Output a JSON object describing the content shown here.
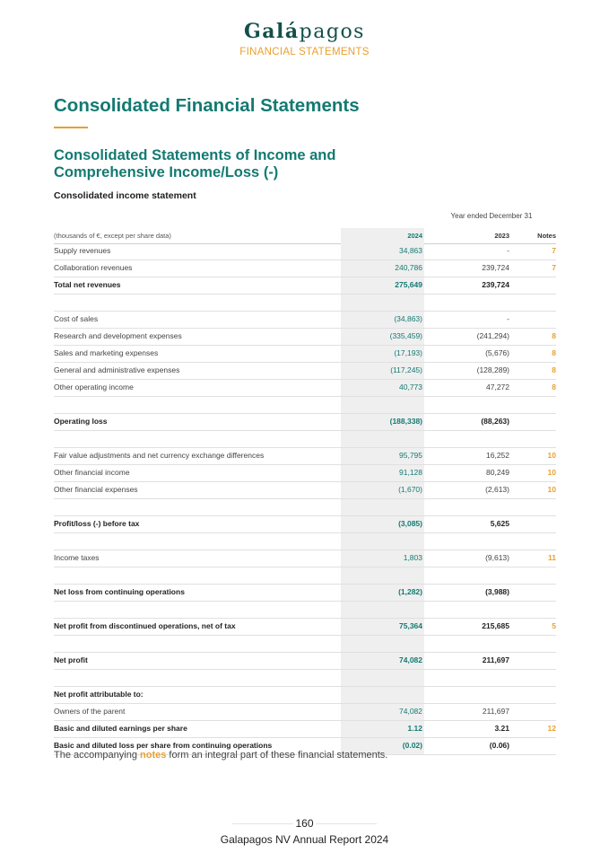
{
  "header": {
    "logo_bold": "Galá",
    "logo_light": "pagos",
    "subtitle": "FINANCIAL STATEMENTS"
  },
  "title": "Consolidated Financial Statements",
  "section_title_line1": "Consolidated Statements of Income and",
  "section_title_line2": "Comprehensive Income/Loss (-)",
  "subsection_title": "Consolidated income statement",
  "table": {
    "period_header": "Year ended December 31",
    "columns": {
      "label": "(thousands of €, except per share data)",
      "y2024": "2024",
      "y2023": "2023",
      "notes": "Notes"
    },
    "rows": [
      {
        "label": "Supply revenues",
        "y2024": "34,863",
        "y2023": "-",
        "note": "7",
        "bold": false
      },
      {
        "label": "Collaboration revenues",
        "y2024": "240,786",
        "y2023": "239,724",
        "note": "7",
        "bold": false
      },
      {
        "label": "Total net revenues",
        "y2024": "275,649",
        "y2023": "239,724",
        "note": "",
        "bold": true
      },
      {
        "label": "",
        "y2024": "",
        "y2023": "",
        "note": "",
        "bold": false
      },
      {
        "label": "Cost of sales",
        "y2024": "(34,863)",
        "y2023": "-",
        "note": "",
        "bold": false
      },
      {
        "label": "Research and development expenses",
        "y2024": "(335,459)",
        "y2023": "(241,294)",
        "note": "8",
        "bold": false
      },
      {
        "label": "Sales and marketing expenses",
        "y2024": "(17,193)",
        "y2023": "(5,676)",
        "note": "8",
        "bold": false
      },
      {
        "label": "General and administrative expenses",
        "y2024": "(117,245)",
        "y2023": "(128,289)",
        "note": "8",
        "bold": false
      },
      {
        "label": "Other operating income",
        "y2024": "40,773",
        "y2023": "47,272",
        "note": "8",
        "bold": false
      },
      {
        "label": "",
        "y2024": "",
        "y2023": "",
        "note": "",
        "bold": false
      },
      {
        "label": "Operating loss",
        "y2024": "(188,338)",
        "y2023": "(88,263)",
        "note": "",
        "bold": true
      },
      {
        "label": "",
        "y2024": "",
        "y2023": "",
        "note": "",
        "bold": false
      },
      {
        "label": "Fair value adjustments and net currency exchange differences",
        "y2024": "95,795",
        "y2023": "16,252",
        "note": "10",
        "bold": false
      },
      {
        "label": "Other financial income",
        "y2024": "91,128",
        "y2023": "80,249",
        "note": "10",
        "bold": false
      },
      {
        "label": "Other financial expenses",
        "y2024": "(1,670)",
        "y2023": "(2,613)",
        "note": "10",
        "bold": false
      },
      {
        "label": "",
        "y2024": "",
        "y2023": "",
        "note": "",
        "bold": false
      },
      {
        "label": "Profit/loss (-) before tax",
        "y2024": "(3,085)",
        "y2023": "5,625",
        "note": "",
        "bold": true
      },
      {
        "label": "",
        "y2024": "",
        "y2023": "",
        "note": "",
        "bold": false
      },
      {
        "label": "Income taxes",
        "y2024": "1,803",
        "y2023": "(9,613)",
        "note": "11",
        "bold": false
      },
      {
        "label": "",
        "y2024": "",
        "y2023": "",
        "note": "",
        "bold": false
      },
      {
        "label": "Net loss from continuing operations",
        "y2024": "(1,282)",
        "y2023": "(3,988)",
        "note": "",
        "bold": true
      },
      {
        "label": "",
        "y2024": "",
        "y2023": "",
        "note": "",
        "bold": false
      },
      {
        "label": "Net profit from discontinued operations, net of tax",
        "y2024": "75,364",
        "y2023": "215,685",
        "note": "5",
        "bold": true
      },
      {
        "label": "",
        "y2024": "",
        "y2023": "",
        "note": "",
        "bold": false
      },
      {
        "label": "Net profit",
        "y2024": "74,082",
        "y2023": "211,697",
        "note": "",
        "bold": true
      },
      {
        "label": "",
        "y2024": "",
        "y2023": "",
        "note": "",
        "bold": false
      },
      {
        "label": "Net profit attributable to:",
        "y2024": "",
        "y2023": "",
        "note": "",
        "bold": true
      },
      {
        "label": "Owners of the parent",
        "y2024": "74,082",
        "y2023": "211,697",
        "note": "",
        "bold": false
      },
      {
        "label": "Basic and diluted earnings per share",
        "y2024": "1.12",
        "y2023": "3.21",
        "note": "12",
        "bold": true
      },
      {
        "label": "Basic and diluted loss per share from continuing operations",
        "y2024": "(0.02)",
        "y2023": "(0.06)",
        "note": "",
        "bold": true
      }
    ]
  },
  "footnote": {
    "before": "The accompanying ",
    "highlight": "notes",
    "after": " form an integral part of these financial statements."
  },
  "footer": {
    "page_number": "160",
    "report_name": "Galapagos NV Annual Report 2024"
  },
  "colors": {
    "brand_teal": "#137a72",
    "accent_orange": "#e8a030",
    "logo_dark": "#14504a"
  }
}
